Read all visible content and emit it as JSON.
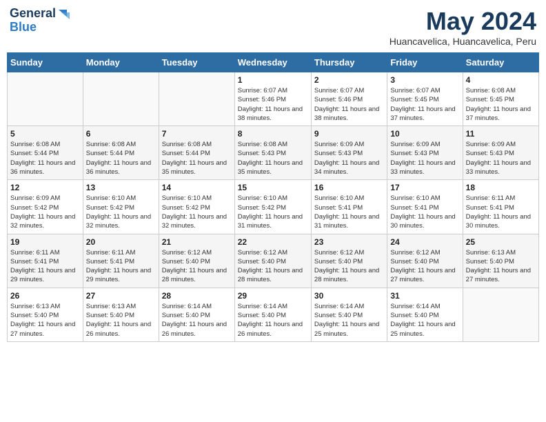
{
  "logo": {
    "line1": "General",
    "line2": "Blue"
  },
  "title": "May 2024",
  "location": "Huancavelica, Huancavelica, Peru",
  "days_of_week": [
    "Sunday",
    "Monday",
    "Tuesday",
    "Wednesday",
    "Thursday",
    "Friday",
    "Saturday"
  ],
  "weeks": [
    [
      {
        "day": "",
        "info": ""
      },
      {
        "day": "",
        "info": ""
      },
      {
        "day": "",
        "info": ""
      },
      {
        "day": "1",
        "info": "Sunrise: 6:07 AM\nSunset: 5:46 PM\nDaylight: 11 hours and 38 minutes."
      },
      {
        "day": "2",
        "info": "Sunrise: 6:07 AM\nSunset: 5:46 PM\nDaylight: 11 hours and 38 minutes."
      },
      {
        "day": "3",
        "info": "Sunrise: 6:07 AM\nSunset: 5:45 PM\nDaylight: 11 hours and 37 minutes."
      },
      {
        "day": "4",
        "info": "Sunrise: 6:08 AM\nSunset: 5:45 PM\nDaylight: 11 hours and 37 minutes."
      }
    ],
    [
      {
        "day": "5",
        "info": "Sunrise: 6:08 AM\nSunset: 5:44 PM\nDaylight: 11 hours and 36 minutes."
      },
      {
        "day": "6",
        "info": "Sunrise: 6:08 AM\nSunset: 5:44 PM\nDaylight: 11 hours and 36 minutes."
      },
      {
        "day": "7",
        "info": "Sunrise: 6:08 AM\nSunset: 5:44 PM\nDaylight: 11 hours and 35 minutes."
      },
      {
        "day": "8",
        "info": "Sunrise: 6:08 AM\nSunset: 5:43 PM\nDaylight: 11 hours and 35 minutes."
      },
      {
        "day": "9",
        "info": "Sunrise: 6:09 AM\nSunset: 5:43 PM\nDaylight: 11 hours and 34 minutes."
      },
      {
        "day": "10",
        "info": "Sunrise: 6:09 AM\nSunset: 5:43 PM\nDaylight: 11 hours and 33 minutes."
      },
      {
        "day": "11",
        "info": "Sunrise: 6:09 AM\nSunset: 5:43 PM\nDaylight: 11 hours and 33 minutes."
      }
    ],
    [
      {
        "day": "12",
        "info": "Sunrise: 6:09 AM\nSunset: 5:42 PM\nDaylight: 11 hours and 32 minutes."
      },
      {
        "day": "13",
        "info": "Sunrise: 6:10 AM\nSunset: 5:42 PM\nDaylight: 11 hours and 32 minutes."
      },
      {
        "day": "14",
        "info": "Sunrise: 6:10 AM\nSunset: 5:42 PM\nDaylight: 11 hours and 32 minutes."
      },
      {
        "day": "15",
        "info": "Sunrise: 6:10 AM\nSunset: 5:42 PM\nDaylight: 11 hours and 31 minutes."
      },
      {
        "day": "16",
        "info": "Sunrise: 6:10 AM\nSunset: 5:41 PM\nDaylight: 11 hours and 31 minutes."
      },
      {
        "day": "17",
        "info": "Sunrise: 6:10 AM\nSunset: 5:41 PM\nDaylight: 11 hours and 30 minutes."
      },
      {
        "day": "18",
        "info": "Sunrise: 6:11 AM\nSunset: 5:41 PM\nDaylight: 11 hours and 30 minutes."
      }
    ],
    [
      {
        "day": "19",
        "info": "Sunrise: 6:11 AM\nSunset: 5:41 PM\nDaylight: 11 hours and 29 minutes."
      },
      {
        "day": "20",
        "info": "Sunrise: 6:11 AM\nSunset: 5:41 PM\nDaylight: 11 hours and 29 minutes."
      },
      {
        "day": "21",
        "info": "Sunrise: 6:12 AM\nSunset: 5:40 PM\nDaylight: 11 hours and 28 minutes."
      },
      {
        "day": "22",
        "info": "Sunrise: 6:12 AM\nSunset: 5:40 PM\nDaylight: 11 hours and 28 minutes."
      },
      {
        "day": "23",
        "info": "Sunrise: 6:12 AM\nSunset: 5:40 PM\nDaylight: 11 hours and 28 minutes."
      },
      {
        "day": "24",
        "info": "Sunrise: 6:12 AM\nSunset: 5:40 PM\nDaylight: 11 hours and 27 minutes."
      },
      {
        "day": "25",
        "info": "Sunrise: 6:13 AM\nSunset: 5:40 PM\nDaylight: 11 hours and 27 minutes."
      }
    ],
    [
      {
        "day": "26",
        "info": "Sunrise: 6:13 AM\nSunset: 5:40 PM\nDaylight: 11 hours and 27 minutes."
      },
      {
        "day": "27",
        "info": "Sunrise: 6:13 AM\nSunset: 5:40 PM\nDaylight: 11 hours and 26 minutes."
      },
      {
        "day": "28",
        "info": "Sunrise: 6:14 AM\nSunset: 5:40 PM\nDaylight: 11 hours and 26 minutes."
      },
      {
        "day": "29",
        "info": "Sunrise: 6:14 AM\nSunset: 5:40 PM\nDaylight: 11 hours and 26 minutes."
      },
      {
        "day": "30",
        "info": "Sunrise: 6:14 AM\nSunset: 5:40 PM\nDaylight: 11 hours and 25 minutes."
      },
      {
        "day": "31",
        "info": "Sunrise: 6:14 AM\nSunset: 5:40 PM\nDaylight: 11 hours and 25 minutes."
      },
      {
        "day": "",
        "info": ""
      }
    ]
  ]
}
